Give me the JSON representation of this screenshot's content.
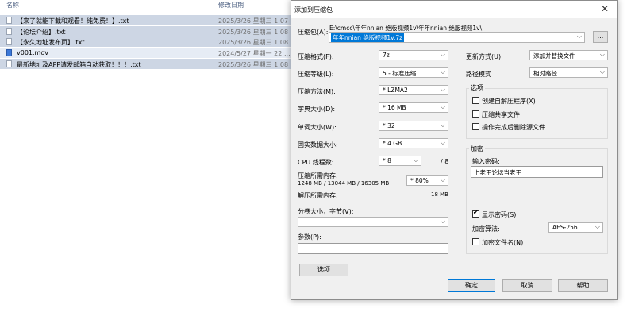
{
  "file_panel": {
    "col_name": "名称",
    "col_date": "修改日期",
    "files": [
      {
        "name": "【来了就能下载和观看！纯免费！】.txt",
        "date": "2025/3/26 星期三 1:07",
        "icon": "txt-file-icon",
        "state": "selected"
      },
      {
        "name": "【论坛介绍】.txt",
        "date": "2025/3/26 星期三 1:08",
        "icon": "txt-file-icon",
        "state": "selected"
      },
      {
        "name": "【永久地址发布页】.txt",
        "date": "2025/3/26 星期三 1:08",
        "icon": "txt-file-icon",
        "state": "selected"
      },
      {
        "name": "v001.mov",
        "date": "2024/5/27 星期一 22:...",
        "icon": "video-file-icon",
        "state": "hover"
      },
      {
        "name": "最新地址及APP请发邮箱自动获取！！！.txt",
        "date": "2025/3/26 星期三 1:08",
        "icon": "txt-file-icon",
        "state": "selected"
      }
    ]
  },
  "dialog": {
    "title": "添加到压缩包",
    "close_icon": "close-icon",
    "archive_label": "压缩包(A):",
    "archive_path": "E:\\cmcc\\年年nnian 绝版视频1v\\年年nnian 绝版视频1v\\",
    "archive_name": "年年nnian 绝版视频1v.7z",
    "browse_label": "...",
    "left_fields": [
      {
        "label": "压缩格式(F):",
        "value": "7z"
      },
      {
        "label": "压缩等级(L):",
        "value": "5 - 标准压缩"
      },
      {
        "label": "压缩方法(M):",
        "value": "* LZMA2"
      },
      {
        "label": "字典大小(D):",
        "value": "* 16 MB"
      },
      {
        "label": "单词大小(W):",
        "value": "* 32"
      },
      {
        "label": "固实数据大小:",
        "value": "* 4 GB"
      },
      {
        "label": "CPU 线程数:",
        "value": "* 8"
      }
    ],
    "cpu_total": "/ 8",
    "mem_compress_label": "压缩所需内存:",
    "mem_compress_detail": "1248 MB / 13044 MB / 16305 MB",
    "mem_percent": "* 80%",
    "mem_decompress_label": "解压所需内存:",
    "mem_decompress_value": "18 MB",
    "split_label": "分卷大小，字节(V):",
    "split_value": "",
    "params_label": "参数(P):",
    "params_value": "",
    "options_button": "选项",
    "update_label": "更新方式(U):",
    "update_value": "添加并替换文件",
    "path_mode_label": "路径模式",
    "path_mode_value": "相对路径",
    "options_group_title": "选项",
    "options": [
      {
        "label": "创建自解压程序(X)",
        "checked": false
      },
      {
        "label": "压缩共享文件",
        "checked": false
      },
      {
        "label": "操作完成后删除源文件",
        "checked": false
      }
    ],
    "encrypt_group_title": "加密",
    "password_label": "输入密码:",
    "password_value": "上老王论坛当老王",
    "show_password_label": "显示密码(S)",
    "show_password_checked": true,
    "enc_method_label": "加密算法:",
    "enc_method_value": "AES-256",
    "encrypt_names_label": "加密文件名(N)",
    "encrypt_names_checked": false,
    "ok_button": "确定",
    "cancel_button": "取消",
    "help_button": "帮助"
  }
}
